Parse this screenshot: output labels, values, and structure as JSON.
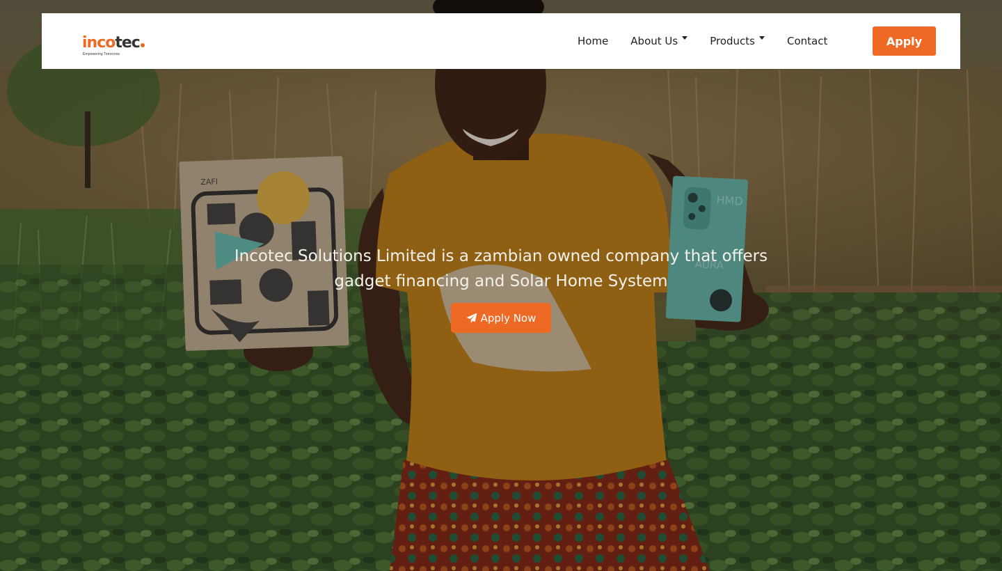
{
  "brand": {
    "logo_part1": "inco",
    "logo_part2": "tec",
    "tagline": "Empowering Tomorrow",
    "accent_color": "#ee6a24"
  },
  "nav": {
    "items": [
      {
        "label": "Home",
        "has_dropdown": false
      },
      {
        "label": "About Us",
        "has_dropdown": true
      },
      {
        "label": "Products",
        "has_dropdown": true
      },
      {
        "label": "Contact",
        "has_dropdown": false
      }
    ],
    "apply_label": "Apply"
  },
  "hero": {
    "headline_line1": "Incotec Solutions Limited is a zambian owned company that offers",
    "headline_line2": "gadget financing and Solar Home System",
    "cta_label": "Apply Now",
    "cta_icon": "paper-plane-icon",
    "box_left_brand": "ZAFI",
    "box_right_brand": "HMD",
    "box_right_model": "AURA"
  }
}
